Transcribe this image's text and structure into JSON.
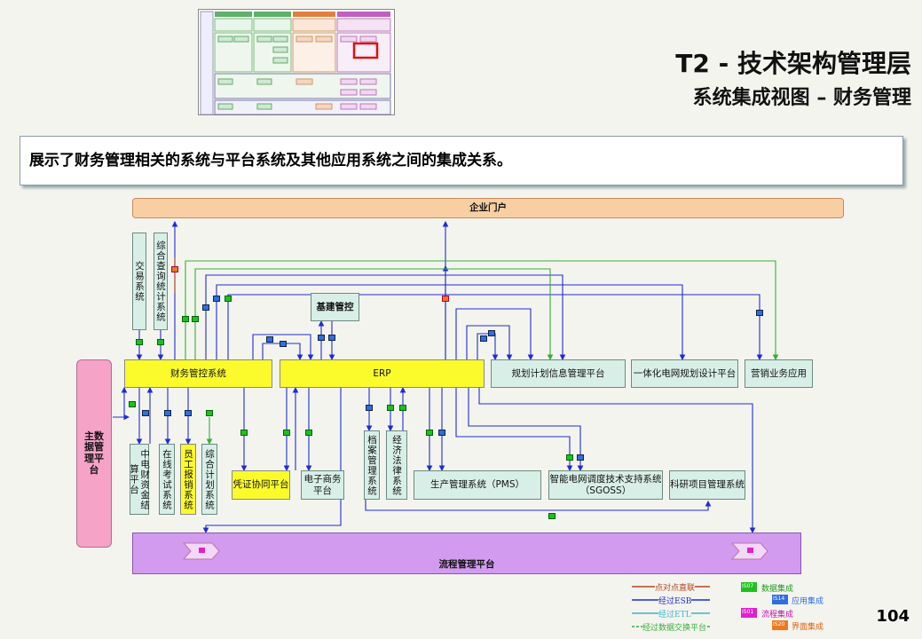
{
  "header": {
    "title": "T2 - 技术架构管理层",
    "subtitle": "系统集成视图 – 财务管理"
  },
  "description": "展示了财务管理相关的系统与平台系统及其他应用系统之间的集成关系。",
  "page_number": "104",
  "nodes": {
    "portal": "企业门户",
    "trade": "交易系统",
    "query_stats": "综合查询统计系统",
    "infra_control": "基建管控",
    "finance_control": "财务管控系统",
    "erp": "ERP",
    "planning_info": "规划计划信息管理平台",
    "grid_design": "一体化电网规划设计平台",
    "marketing": "营销业务应用",
    "master_data": "主数据管理平台",
    "cecf_settlement": "中电财资金结算平台",
    "online_exam": "在线考试系统",
    "staff_reimb": "员工报销系统",
    "integrated_plan": "综合计划系统",
    "voucher": "凭证协同平台",
    "ecommerce": "电子商务平台",
    "archive": "档案管理系统",
    "econ_law": "经济法律系统",
    "pms": "生产管理系统（PMS）",
    "sgoss_line1": "智能电网调度技术支持系统",
    "sgoss_line2": "（SGOSS）",
    "research": "科研项目管理系统",
    "workflow": "流程管理平台"
  },
  "integration_badges": {
    "data": "IS07",
    "app": "IS14",
    "process": "IS01",
    "ui": "IS20"
  },
  "legend": {
    "items": [
      {
        "label": "点对点直联",
        "color": "#b5441d"
      },
      {
        "label": "经过ESB",
        "color": "#1f2bd6"
      },
      {
        "label": "经过ETL",
        "color": "#3ab6c9"
      },
      {
        "label": "经过数据交换平台",
        "color": "#35b035"
      }
    ],
    "badges": [
      {
        "code": "IS07",
        "label": "数据集成",
        "color": "#1fbf1f"
      },
      {
        "code": "IS14",
        "label": "应用集成",
        "color": "#2f6de0"
      },
      {
        "code": "IS01",
        "label": "流程集成",
        "color": "#e020d0"
      },
      {
        "code": "IS20",
        "label": "界面集成",
        "color": "#f07820"
      }
    ]
  },
  "colors": {
    "esb": "#1f2bd6",
    "exchange": "#35b035",
    "direct": "#b5441d"
  }
}
